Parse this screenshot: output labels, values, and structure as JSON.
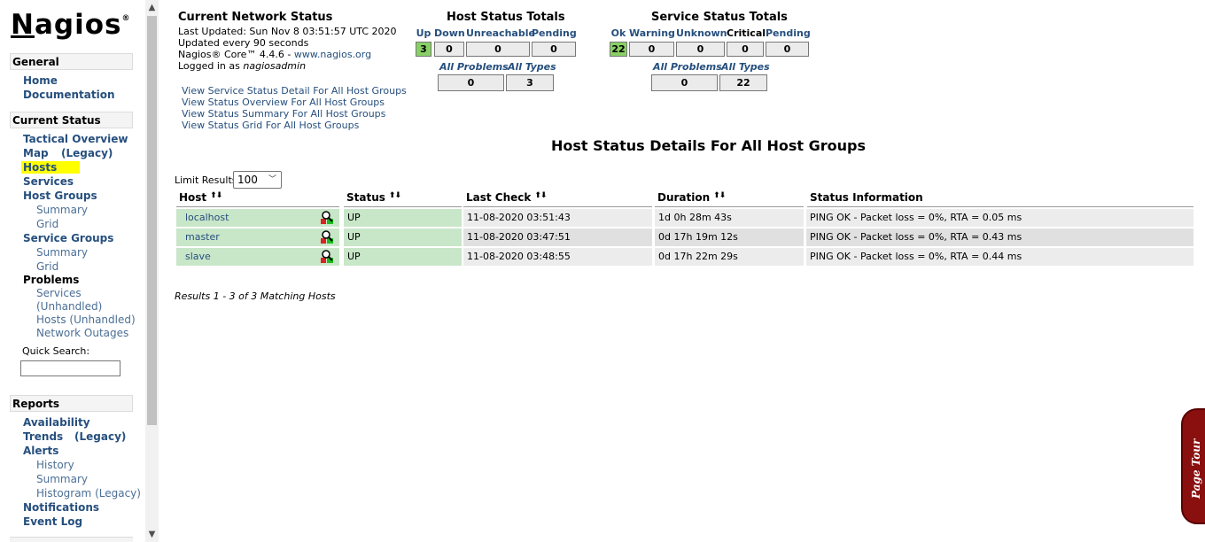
{
  "sidebar": {
    "logo": "Nagios",
    "logo_mark": "®",
    "sections": {
      "general": "General",
      "current_status": "Current Status",
      "reports": "Reports"
    },
    "general_items": [
      "Home",
      "Documentation"
    ],
    "current": {
      "tactical": "Tactical Overview",
      "map": "Map",
      "map_legacy": "(Legacy)",
      "hosts": "Hosts",
      "services": "Services",
      "host_groups": "Host Groups",
      "hg_summary": "Summary",
      "hg_grid": "Grid",
      "service_groups": "Service Groups",
      "sg_summary": "Summary",
      "sg_grid": "Grid",
      "problems": "Problems",
      "p_services": "Services",
      "p_unhandled": "(Unhandled)",
      "p_hosts": "Hosts (Unhandled)",
      "p_outages": "Network Outages",
      "quick_search": "Quick Search:"
    },
    "reports": {
      "availability": "Availability",
      "trends": "Trends",
      "trends_legacy": "(Legacy)",
      "alerts": "Alerts",
      "history": "History",
      "summary": "Summary",
      "histogram": "Histogram (Legacy)",
      "notifications": "Notifications",
      "event_log": "Event Log"
    }
  },
  "status_info": {
    "title": "Current Network Status",
    "last_updated": "Last Updated: Sun Nov 8 03:51:57 UTC 2020",
    "update_every": "Updated every 90 seconds",
    "core_prefix": "Nagios® Core™ 4.4.6 - ",
    "core_link": "www.nagios.org",
    "logged_in_prefix": "Logged in as ",
    "user": "nagiosadmin"
  },
  "links": [
    "View Service Status Detail For All Host Groups",
    "View Status Overview For All Host Groups",
    "View Status Summary For All Host Groups",
    "View Status Grid For All Host Groups"
  ],
  "host_totals": {
    "title": "Host Status Totals",
    "labels": [
      "Up",
      "Down",
      "Unreachable",
      "Pending"
    ],
    "values": [
      "3",
      "0",
      "0",
      "0"
    ],
    "sub_labels": [
      "All Problems",
      "All Types"
    ],
    "sub_values": [
      "0",
      "3"
    ]
  },
  "service_totals": {
    "title": "Service Status Totals",
    "labels": [
      "Ok",
      "Warning",
      "Unknown",
      "Critical",
      "Pending"
    ],
    "values": [
      "22",
      "0",
      "0",
      "0",
      "0"
    ],
    "sub_labels": [
      "All Problems",
      "All Types"
    ],
    "sub_values": [
      "0",
      "22"
    ]
  },
  "details": {
    "title": "Host Status Details For All Host Groups",
    "limit_label": "Limit Results:",
    "limit_value": "100",
    "columns": [
      "Host",
      "Status",
      "Last Check",
      "Duration",
      "Status Information"
    ],
    "rows": [
      {
        "host": "localhost",
        "status": "UP",
        "last_check": "11-08-2020 03:51:43",
        "duration": "1d 0h 28m 43s",
        "info": "PING OK - Packet loss = 0%, RTA = 0.05 ms"
      },
      {
        "host": "master",
        "status": "UP",
        "last_check": "11-08-2020 03:47:51",
        "duration": "0d 17h 19m 12s",
        "info": "PING OK - Packet loss = 0%, RTA = 0.43 ms"
      },
      {
        "host": "slave",
        "status": "UP",
        "last_check": "11-08-2020 03:48:55",
        "duration": "0d 17h 22m 29s",
        "info": "PING OK - Packet loss = 0%, RTA = 0.44 ms"
      }
    ],
    "results_text": "Results 1 - 3 of 3 Matching Hosts"
  },
  "page_tour": "Page Tour",
  "colors": {
    "up_green": "#88d066",
    "row_green": "#c8e6c8",
    "link_blue": "#264f7e",
    "highlight": "#ffff00",
    "tour_red": "#8a1010"
  }
}
